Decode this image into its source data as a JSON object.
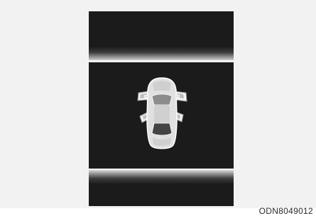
{
  "figure": {
    "code": "ODN8049012"
  },
  "display": {
    "icon": "car-top-view-doors-open-icon",
    "state": "all doors open"
  },
  "colors": {
    "screen_bg": "#1b1b1b",
    "car_body": "#d9d9d9",
    "car_outline": "#ffffff"
  }
}
